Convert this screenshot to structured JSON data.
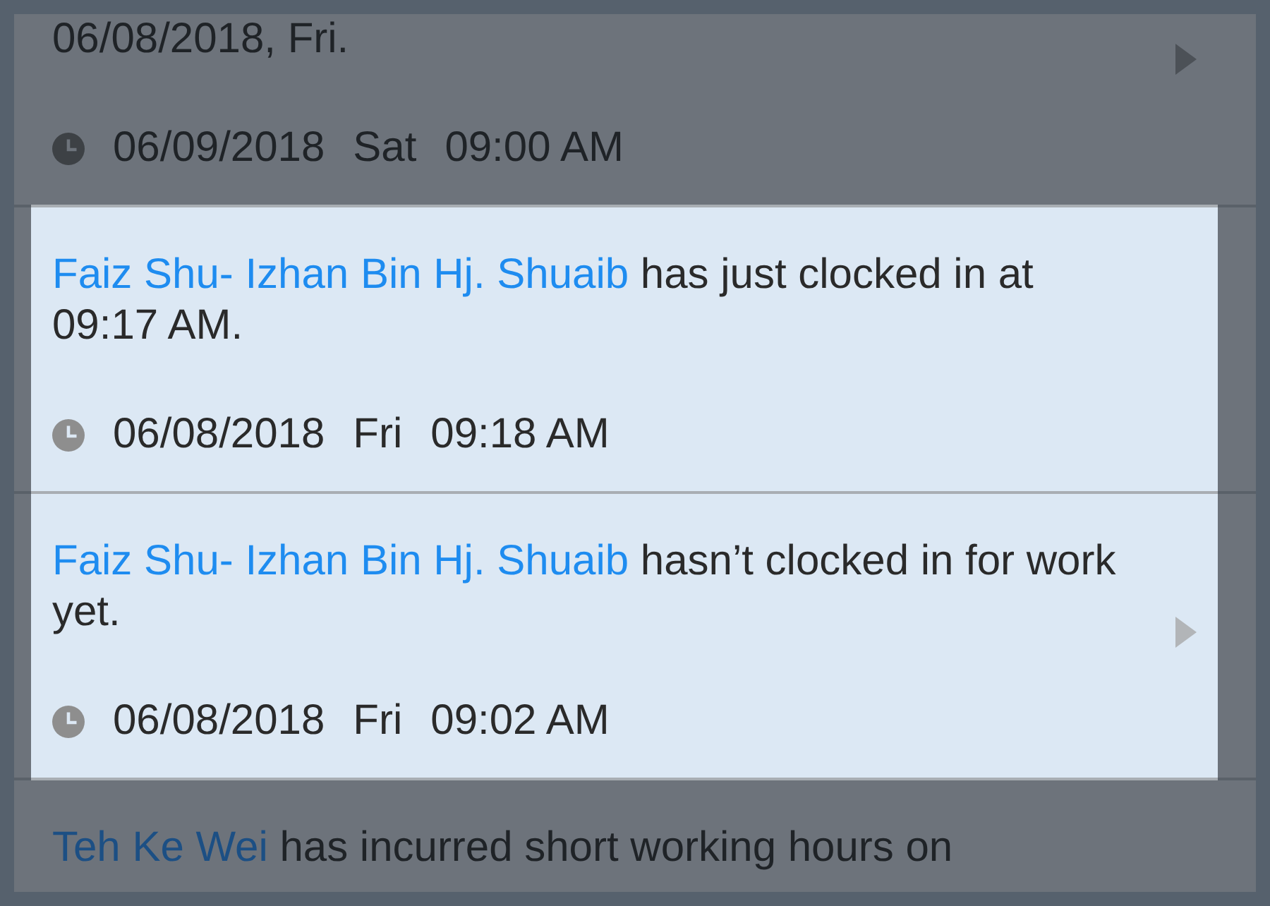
{
  "notifications": [
    {
      "highlighted": false,
      "chevron": true,
      "message": {
        "text": "06/08/2018, Fri."
      },
      "timestamp": {
        "date": "06/09/2018",
        "weekday": "Sat",
        "time": "09:00 AM"
      }
    },
    {
      "highlighted": true,
      "chevron": false,
      "message": {
        "name": "Faiz Shu- Izhan Bin Hj. Shuaib",
        "text": "has just clocked in at 09:17 AM."
      },
      "timestamp": {
        "date": "06/08/2018",
        "weekday": "Fri",
        "time": "09:18 AM"
      }
    },
    {
      "highlighted": true,
      "chevron": true,
      "message": {
        "name": "Faiz Shu- Izhan Bin Hj. Shuaib",
        "text": "hasn’t clocked in for work yet."
      },
      "timestamp": {
        "date": "06/08/2018",
        "weekday": "Fri",
        "time": "09:02 AM"
      }
    },
    {
      "highlighted": false,
      "chevron": false,
      "message": {
        "name": "Teh Ke Wei",
        "text": "has incurred short working hours on"
      }
    }
  ]
}
